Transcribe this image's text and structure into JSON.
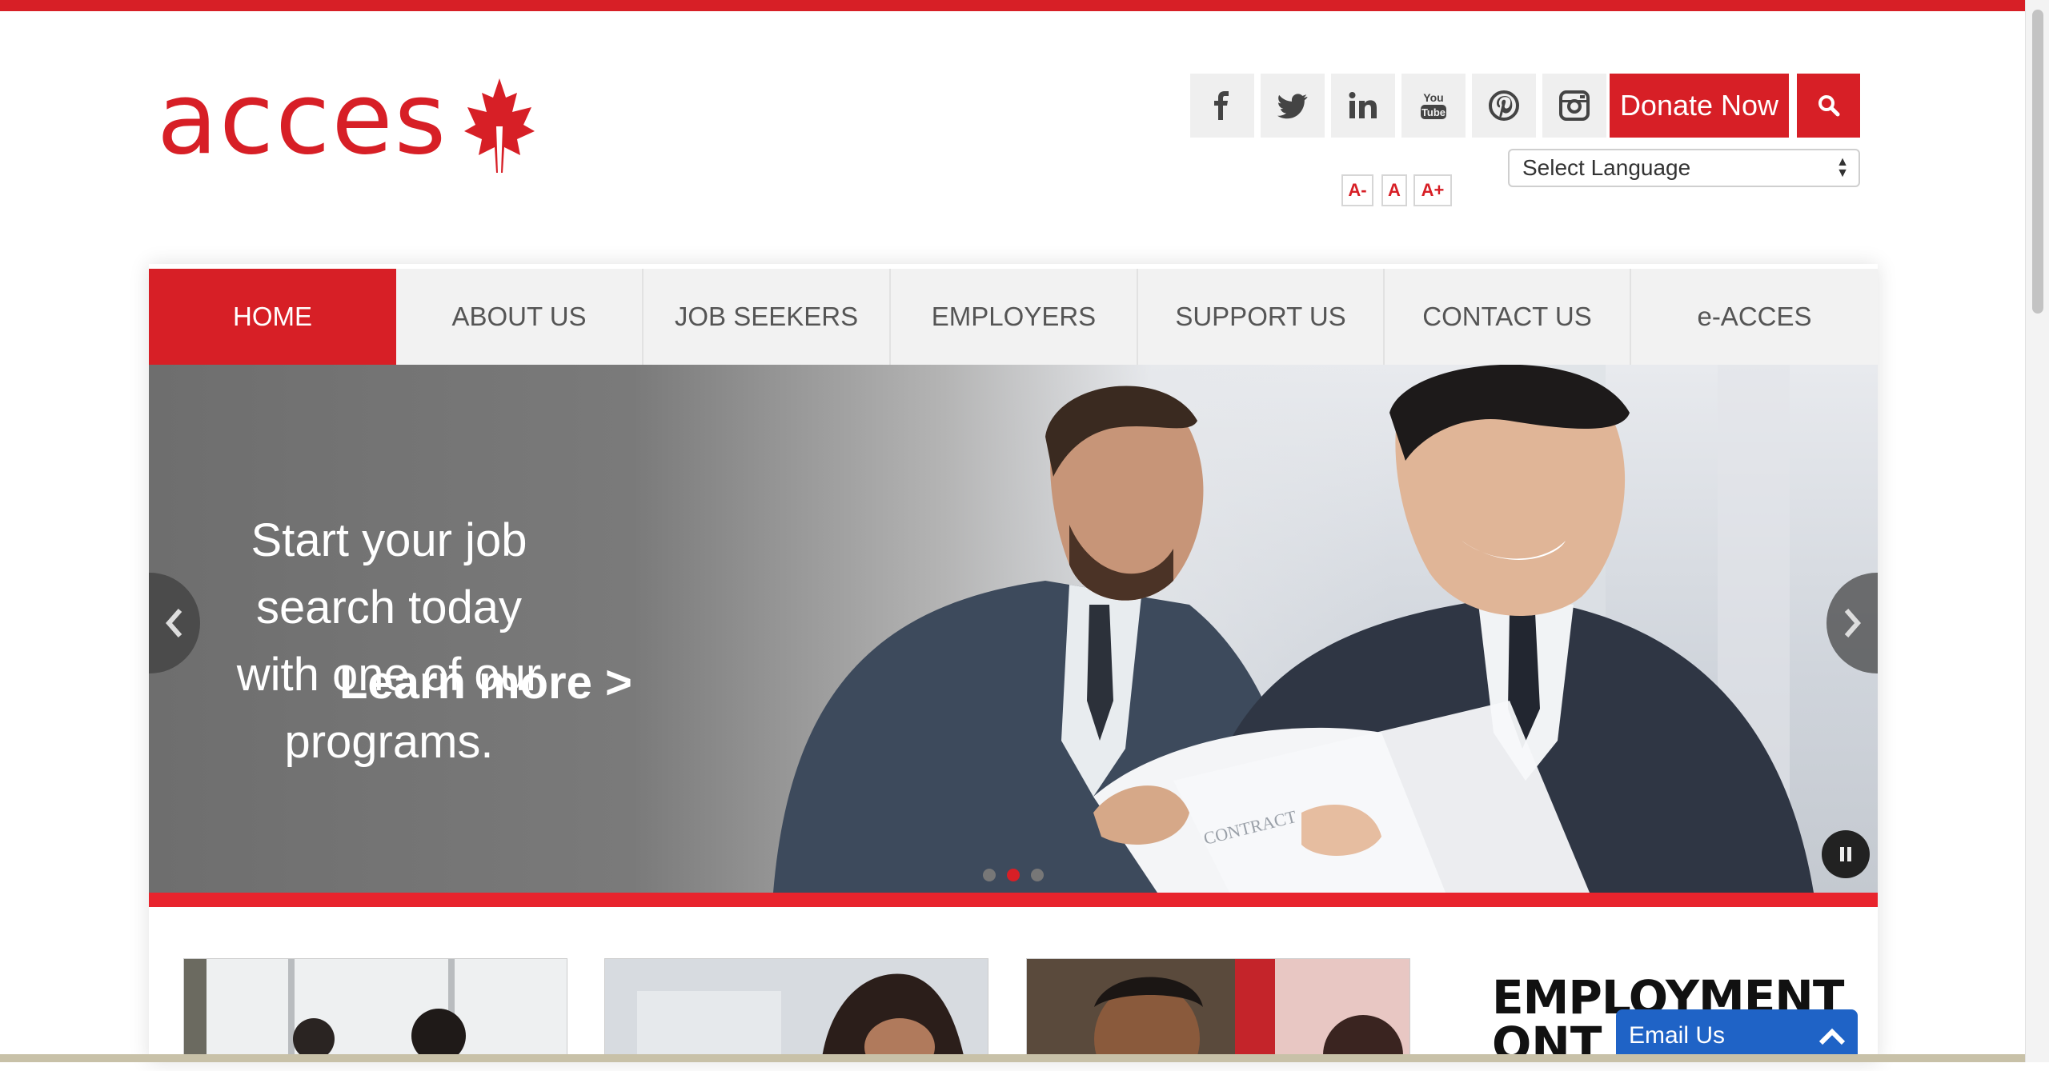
{
  "brand": {
    "name": "acces",
    "color": "#d71f26"
  },
  "social": [
    {
      "name": "facebook-icon"
    },
    {
      "name": "twitter-icon"
    },
    {
      "name": "linkedin-icon"
    },
    {
      "name": "youtube-icon",
      "label": "You Tube"
    },
    {
      "name": "pinterest-icon"
    },
    {
      "name": "instagram-icon"
    }
  ],
  "header": {
    "donate_label": "Donate Now",
    "language_select": "Select Language",
    "font_size": {
      "decrease": "A-",
      "reset": "A",
      "increase": "A+"
    }
  },
  "nav": {
    "items": [
      {
        "label": "HOME",
        "active": true
      },
      {
        "label": "ABOUT US",
        "active": false
      },
      {
        "label": "JOB SEEKERS",
        "active": false
      },
      {
        "label": "EMPLOYERS",
        "active": false
      },
      {
        "label": "SUPPORT US",
        "active": false
      },
      {
        "label": "CONTACT US",
        "active": false
      },
      {
        "label": "e-ACCES",
        "active": false
      }
    ]
  },
  "hero": {
    "headline_line1": "Start your job search today",
    "headline_line2": "with one of our programs.",
    "link_label": "Learn more >",
    "slides_total": 3,
    "active_slide": 2,
    "document_text": "CONTRACT"
  },
  "section": {
    "heading_line1": "EMPLOYMENT",
    "heading_line2": "ONT"
  },
  "email_widget": {
    "label": "Email Us"
  }
}
